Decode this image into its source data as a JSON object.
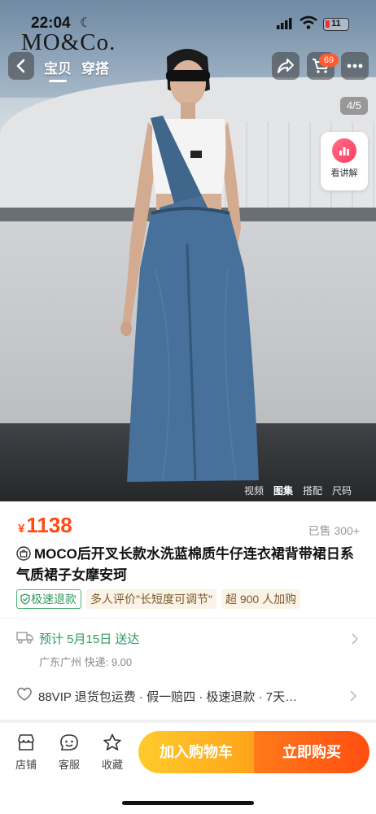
{
  "status_bar": {
    "time": "22:04",
    "battery": "11"
  },
  "brand": "MO&Co.",
  "nav": {
    "tabs": [
      {
        "label": "宝贝",
        "active": true
      },
      {
        "label": "穿搭",
        "active": false
      }
    ],
    "cart_count": "69",
    "page_indicator": "4/5",
    "live_label": "看讲解"
  },
  "media_tabs": [
    "视频",
    "图集",
    "搭配",
    "尺码"
  ],
  "product": {
    "currency": "¥",
    "price": "1138",
    "sold": "已售 300+",
    "title": "MOCO后开叉长款水洗蓝棉质牛仔连衣裙背带裙日系气质裙子女摩安珂",
    "tags": [
      "极速退款",
      "多人评价\"长短度可调节\"",
      "超 900 人加购"
    ]
  },
  "shipping": {
    "eta": "预计 5月15日 送达",
    "origin": "广东广州  快递: 9.00"
  },
  "service": {
    "text": "88VIP 退货包运费 · 假一赔四 · 极速退款 · 7天…"
  },
  "bottom_bar": {
    "items": [
      "店铺",
      "客服",
      "收藏"
    ],
    "add_to_cart": "加入购物车",
    "buy_now": "立即购买"
  },
  "colors": {
    "price": "#ff4b12",
    "green": "#2d9b5e",
    "cart_btn": "#ffb21f",
    "buy_btn": "#ff5a14"
  }
}
